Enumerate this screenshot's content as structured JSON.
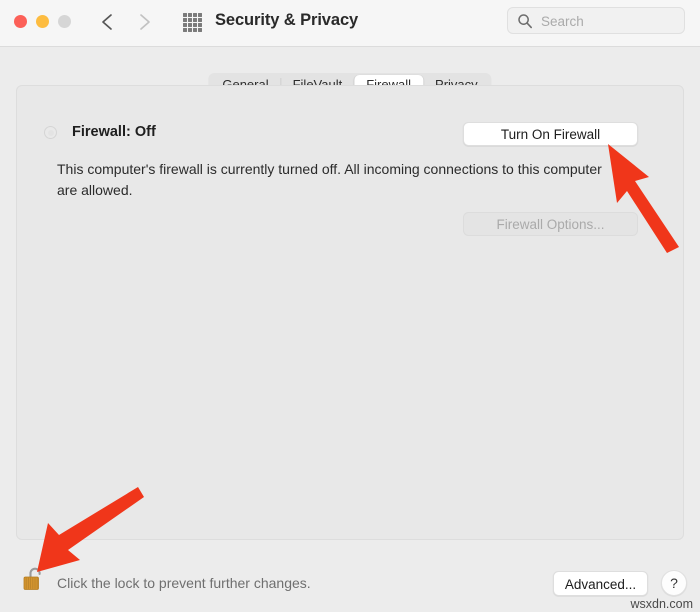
{
  "window": {
    "title": "Security & Privacy",
    "traffic_lights": [
      {
        "name": "close",
        "color": "#fc6058"
      },
      {
        "name": "minimize",
        "color": "#fdbc40"
      },
      {
        "name": "zoom",
        "color": "#d6d6d6"
      }
    ],
    "nav": {
      "back_icon": "chevron-left-icon",
      "forward_icon": "chevron-right-icon",
      "grid_icon": "grid-apps-icon"
    }
  },
  "search": {
    "placeholder": "Search",
    "value": "",
    "icon": "search-icon"
  },
  "tabs": [
    {
      "label": "General",
      "selected": false
    },
    {
      "label": "FileVault",
      "selected": false
    },
    {
      "label": "Firewall",
      "selected": true
    },
    {
      "label": "Privacy",
      "selected": false
    }
  ],
  "main": {
    "status_label": "Firewall: Off",
    "status_indicator": "status-dot-off",
    "description": "This computer's firewall is currently turned off. All incoming connections to this computer are allowed.",
    "turn_on_button": "Turn On Firewall",
    "options_button": "Firewall Options...",
    "options_button_disabled": true
  },
  "footer": {
    "lock_icon": "unlocked-padlock-icon",
    "lock_text": "Click the lock to prevent further changes.",
    "advanced_button": "Advanced...",
    "help_button": "?"
  },
  "annotations": {
    "arrow_color": "#f0361a",
    "arrow_to_turn_on_firewall": "arrow-pointing-up-left",
    "arrow_to_lock": "arrow-pointing-down-left"
  },
  "watermark": "wsxdn.com"
}
